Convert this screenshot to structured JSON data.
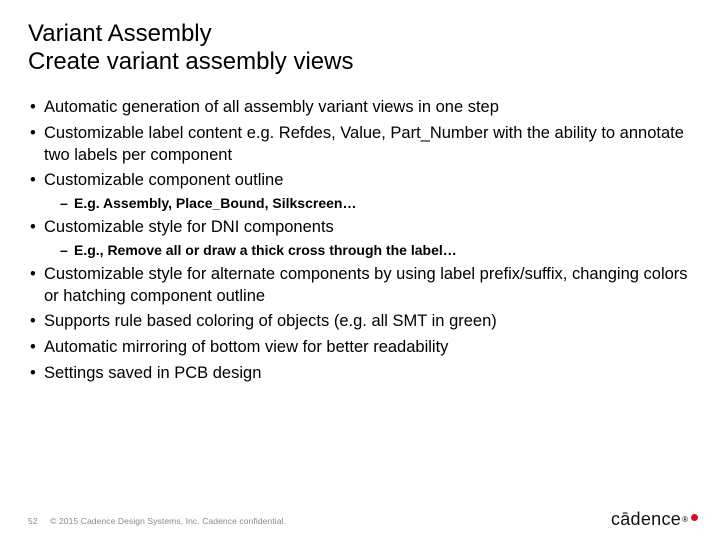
{
  "title_line1": "Variant Assembly",
  "title_line2": "Create variant assembly views",
  "bullets": {
    "b0": "Automatic generation of all assembly variant views in one step",
    "b1": "Customizable label content e.g. Refdes, Value, Part_Number with the ability to annotate two labels per component",
    "b2": "Customizable component outline",
    "b2_sub0": "E.g. Assembly, Place_Bound, Silkscreen…",
    "b3": "Customizable style for DNI components",
    "b3_sub0": "E.g., Remove all or draw a thick cross through the label…",
    "b4": "Customizable style for alternate components by using label prefix/suffix, changing colors or hatching component outline",
    "b5": "Supports rule based coloring of objects (e.g. all SMT in green)",
    "b6": "Automatic mirroring of bottom view for better readability",
    "b7": "Settings saved in PCB design"
  },
  "footer": {
    "page": "52",
    "copyright": "© 2015 Cadence Design Systems, Inc. Cadence confidential."
  },
  "logo": {
    "text": "cādence",
    "reg": "®"
  }
}
